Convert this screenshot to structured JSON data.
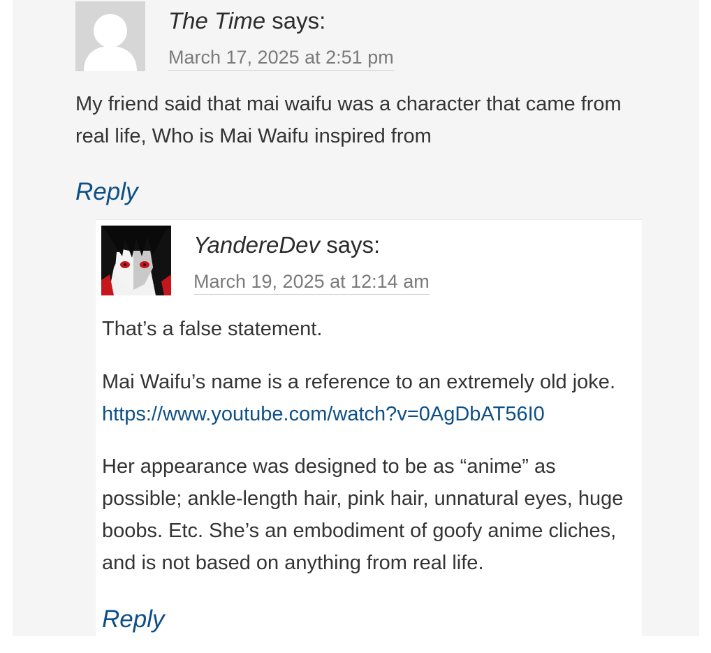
{
  "comment1": {
    "author": "The Time",
    "says": "says:",
    "date": "March 17, 2025 at 2:51 pm",
    "text": "My friend said that mai waifu was a character that came from real life, Who is Mai Waifu inspired from",
    "reply_label": "Reply",
    "avatar_icon": "default-user-avatar-icon"
  },
  "comment2": {
    "author": "YandereDev",
    "says": "says:",
    "date": "March 19, 2025 at 12:14 am",
    "p1": "That’s a false statement.",
    "p2_text": "Mai Waifu’s name is a reference to an extremely old joke. ",
    "p2_link": "https://www.youtube.com/watch?v=0AgDbAT56I0",
    "p3": "Her appearance was designed to be as “anime” as possible; ankle-length hair, pink hair, unnatural eyes, huge boobs. Etc. She’s an embodiment of goofy anime cliches, and is not based on anything from real life.",
    "reply_label": "Reply",
    "avatar_icon": "anime-character-avatar-icon"
  },
  "colors": {
    "outer_bg": "#f5f5f5",
    "inner_bg": "#ffffff",
    "link": "#0d4f86",
    "text": "#333333",
    "meta": "#7a7a7a"
  }
}
